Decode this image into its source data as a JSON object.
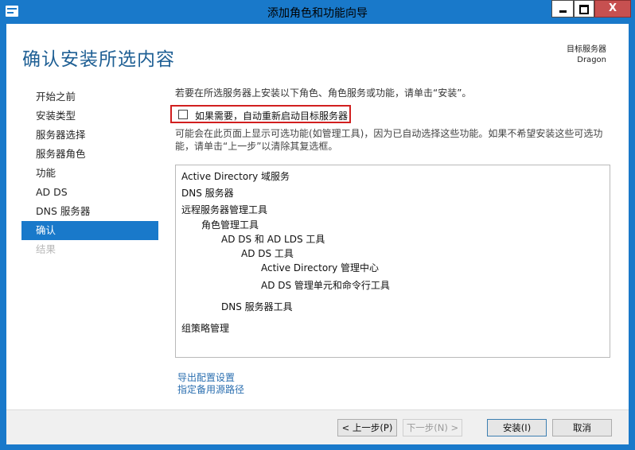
{
  "window": {
    "title": "添加角色和功能向导",
    "minimize_label": "",
    "maximize_label": "",
    "close_label": "X"
  },
  "page": {
    "title": "确认安装所选内容",
    "target_label": "目标服务器",
    "target_name": "Dragon"
  },
  "nav": {
    "items": [
      {
        "label": "开始之前"
      },
      {
        "label": "安装类型"
      },
      {
        "label": "服务器选择"
      },
      {
        "label": "服务器角色"
      },
      {
        "label": "功能"
      },
      {
        "label": "AD DS"
      },
      {
        "label": "DNS 服务器"
      },
      {
        "label": "确认"
      },
      {
        "label": "结果"
      }
    ]
  },
  "content": {
    "intro": "若要在所选服务器上安装以下角色、角色服务或功能，请单击“安装”。",
    "restart_label": "如果需要，自动重新启动目标服务器",
    "info_line1": "可能会在此页面上显示可选功能(如管理工具)，因为已自动选择这些功能。如果不希望安装这些可选功",
    "info_line2": "能，请单击“上一步”以清除其复选框。",
    "features": [
      "Active Directory 域服务",
      "DNS 服务器",
      "远程服务器管理工具",
      "角色管理工具",
      "AD DS 和 AD LDS 工具",
      "AD DS 工具",
      "Active Directory 管理中心",
      "AD DS 管理单元和命令行工具",
      "DNS 服务器工具",
      "组策略管理"
    ],
    "export_link": "导出配置设置",
    "alt_source_link": "指定备用源路径"
  },
  "footer": {
    "previous": "< 上一步(P)",
    "next": "下一步(N) >",
    "install": "安装(I)",
    "cancel": "取消"
  }
}
